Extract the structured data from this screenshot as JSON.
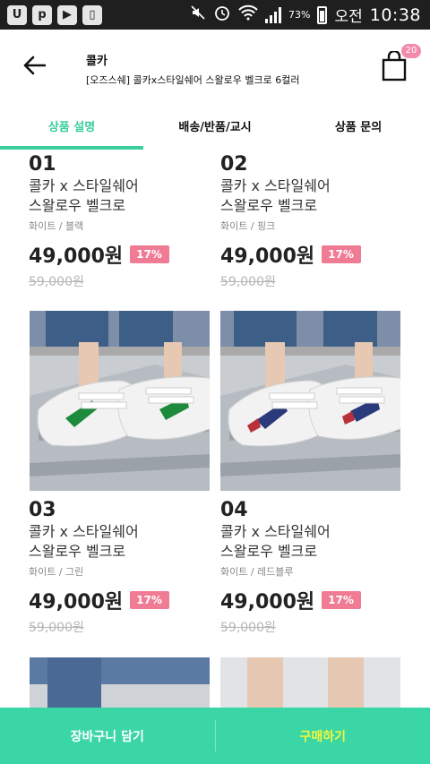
{
  "status_bar": {
    "battery_text": "73%",
    "ampm": "오전",
    "time": "10:38",
    "left_icons": [
      "app-u-icon",
      "app-p-icon",
      "play-store-icon",
      "device-icon"
    ],
    "right_icons": [
      "mute-icon",
      "alarm-icon",
      "wifi-icon",
      "signal-icon",
      "battery-icon"
    ]
  },
  "header": {
    "brand": "콜카",
    "product": "[오즈스쉐] 콜카x스타일쉐어 스왈로우 벨크로 6컬러",
    "cart_count": "20"
  },
  "tabs": [
    {
      "label": "상품 설명",
      "active": true
    },
    {
      "label": "배송/반품/교시",
      "active": false
    },
    {
      "label": "상품 문의",
      "active": false
    }
  ],
  "products": [
    {
      "number": "01",
      "line1": "콜카 x 스타일쉐어",
      "line2": "스왈로우 벨크로",
      "option": "화이트 / 블랙",
      "price": "49,000원",
      "discount": "17%",
      "original": "59,000원"
    },
    {
      "number": "02",
      "line1": "콜카 x 스타일쉐어",
      "line2": "스왈로우 벨크로",
      "option": "화이트 / 핑크",
      "price": "49,000원",
      "discount": "17%",
      "original": "59,000원"
    },
    {
      "number": "03",
      "line1": "콜카 x 스타일쉐어",
      "line2": "스왈로우 벨크로",
      "option": "화이트 / 그린",
      "price": "49,000원",
      "discount": "17%",
      "original": "59,000원",
      "stripe_color": "#1e8a3c"
    },
    {
      "number": "04",
      "line1": "콜카 x 스타일쉐어",
      "line2": "스왈로우 벨크로",
      "option": "화이트 / 레드블루",
      "price": "49,000원",
      "discount": "17%",
      "original": "59,000원",
      "stripe_color": "#2a3a7a"
    }
  ],
  "bottom_bar": {
    "cart_label": "장바구니 담기",
    "buy_label": "구매하기"
  },
  "colors": {
    "accent": "#3ccf9e",
    "bottom_bar": "#3ad6a6",
    "buy_text": "#f3f83a",
    "discount_badge": "#f07b94",
    "cart_badge": "#f28bab"
  }
}
